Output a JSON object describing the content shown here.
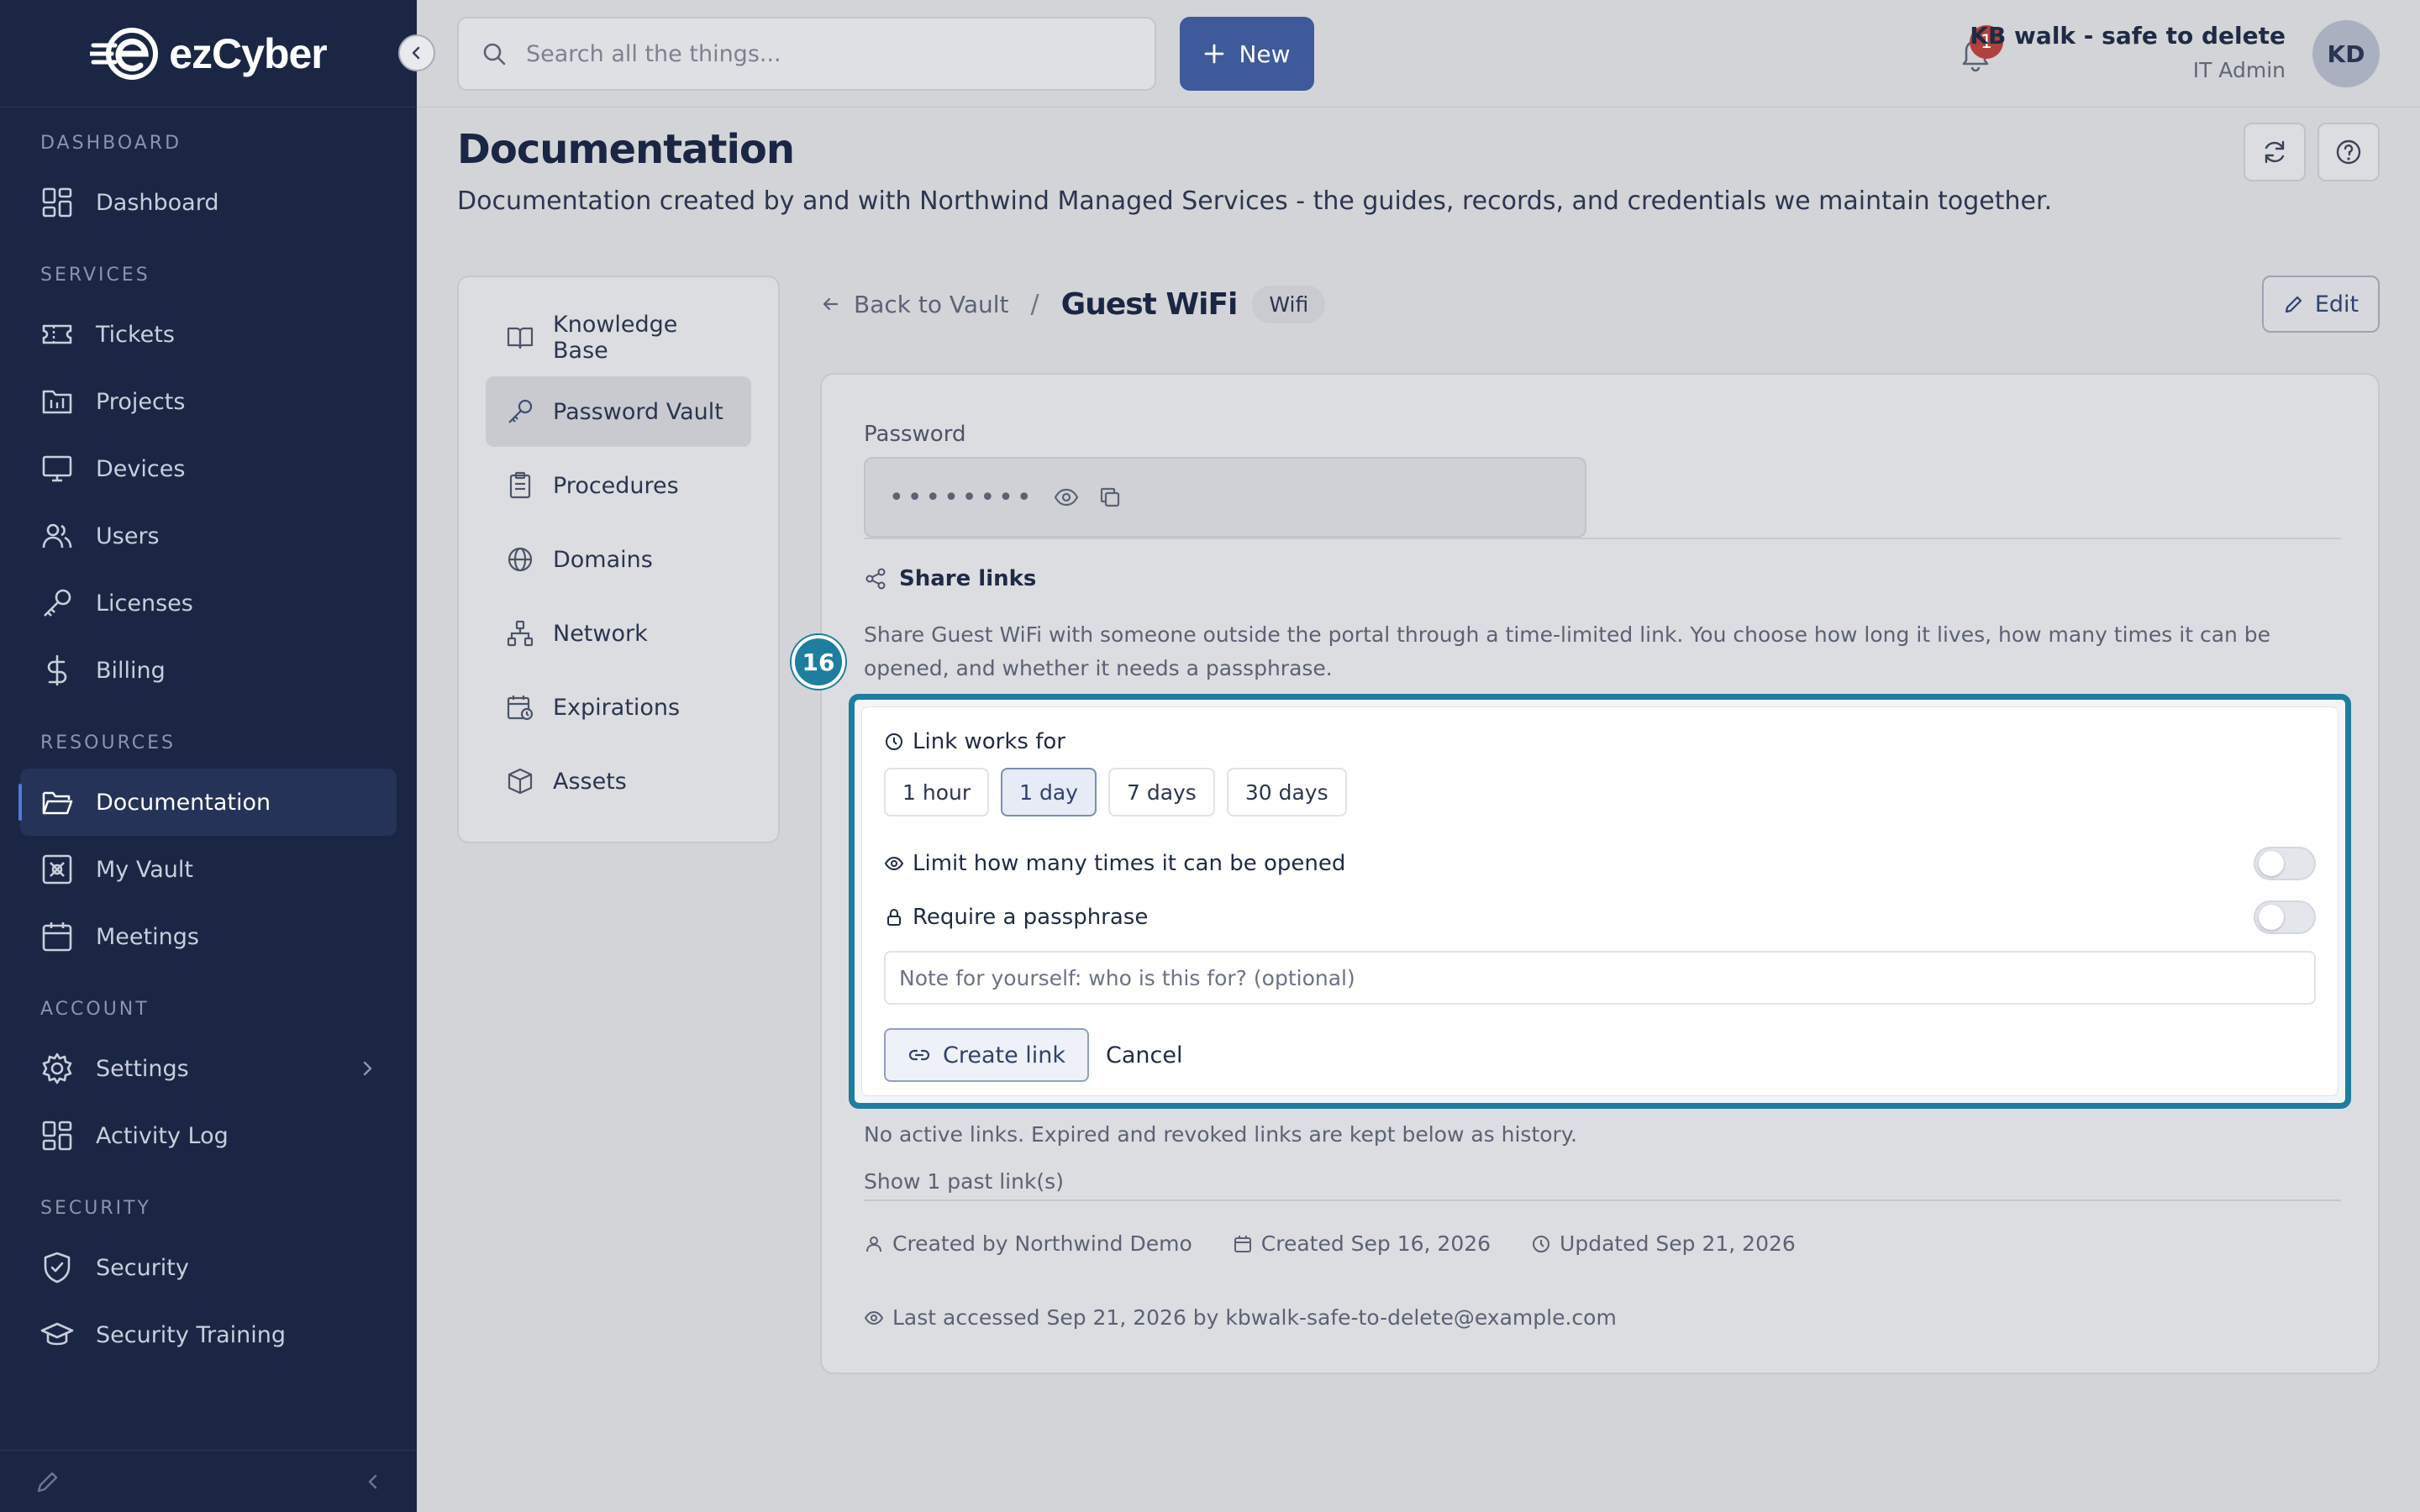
{
  "app": {
    "brand": "ezCyber"
  },
  "search": {
    "placeholder": "Search all the things..."
  },
  "new_button": {
    "label": "New"
  },
  "notifications": {
    "count": "1"
  },
  "user": {
    "name": "KB walk - safe to delete",
    "role": "IT Admin",
    "initials": "KD"
  },
  "sidebar": {
    "sections": [
      {
        "title": "DASHBOARD",
        "items": [
          {
            "label": "Dashboard",
            "icon": "dashboard-icon"
          }
        ]
      },
      {
        "title": "SERVICES",
        "items": [
          {
            "label": "Tickets",
            "icon": "ticket-icon"
          },
          {
            "label": "Projects",
            "icon": "projects-icon"
          },
          {
            "label": "Devices",
            "icon": "monitor-icon"
          },
          {
            "label": "Users",
            "icon": "users-icon"
          },
          {
            "label": "Licenses",
            "icon": "key-icon"
          },
          {
            "label": "Billing",
            "icon": "dollar-icon"
          }
        ]
      },
      {
        "title": "RESOURCES",
        "items": [
          {
            "label": "Documentation",
            "icon": "folder-icon",
            "active": true
          },
          {
            "label": "My Vault",
            "icon": "vault-icon"
          },
          {
            "label": "Meetings",
            "icon": "calendar-icon"
          }
        ]
      },
      {
        "title": "ACCOUNT",
        "items": [
          {
            "label": "Settings",
            "icon": "gear-icon"
          },
          {
            "label": "Activity Log",
            "icon": "activity-icon"
          }
        ]
      },
      {
        "title": "SECURITY",
        "items": [
          {
            "label": "Security",
            "icon": "shield-icon"
          },
          {
            "label": "Security Training",
            "icon": "graduation-icon"
          }
        ]
      }
    ]
  },
  "page": {
    "title": "Documentation",
    "description": "Documentation created by and with Northwind Managed Services - the guides, records, and credentials we maintain together."
  },
  "docs_menu": {
    "items": [
      {
        "label": "Knowledge Base",
        "icon": "book-icon"
      },
      {
        "label": "Password Vault",
        "icon": "key-icon",
        "active": true
      },
      {
        "label": "Procedures",
        "icon": "clipboard-icon"
      },
      {
        "label": "Domains",
        "icon": "globe-icon"
      },
      {
        "label": "Network",
        "icon": "network-icon"
      },
      {
        "label": "Expirations",
        "icon": "calendar-clock-icon"
      },
      {
        "label": "Assets",
        "icon": "box-icon"
      }
    ]
  },
  "breadcrumb": {
    "back_label": "Back to Vault",
    "separator": "/",
    "title": "Guest WiFi",
    "tag": "Wifi"
  },
  "edit_button": {
    "label": "Edit"
  },
  "record": {
    "password_label": "Password",
    "password_mask": "••••••••",
    "share_title": "Share links",
    "share_description": "Share Guest WiFi with someone outside the portal through a time-limited link. You choose how long it lives, how many times it can be opened, and whether it needs a passphrase.",
    "step_badge": "16",
    "form": {
      "link_works_for_label": "Link works for",
      "durations": [
        "1 hour",
        "1 day",
        "7 days",
        "30 days"
      ],
      "selected_duration": "1 day",
      "limit_label": "Limit how many times it can be opened",
      "limit_enabled": false,
      "passphrase_label": "Require a passphrase",
      "passphrase_enabled": false,
      "note_placeholder": "Note for yourself: who is this for? (optional)",
      "create_label": "Create link",
      "cancel_label": "Cancel"
    },
    "no_links_text": "No active links. Expired and revoked links are kept below as history.",
    "past_links_text": "Show 1 past link(s)",
    "created_by": "Created by Northwind Demo",
    "created": "Created Sep 16, 2026",
    "updated": "Updated Sep 21, 2026",
    "last_accessed": "Last accessed Sep 21, 2026 by kbwalk-safe-to-delete@example.com"
  },
  "colors": {
    "sidebar_bg": "#1a2644",
    "accent": "#3e5a9a",
    "highlight": "#1d7ea0",
    "badge": "#b0413f"
  }
}
